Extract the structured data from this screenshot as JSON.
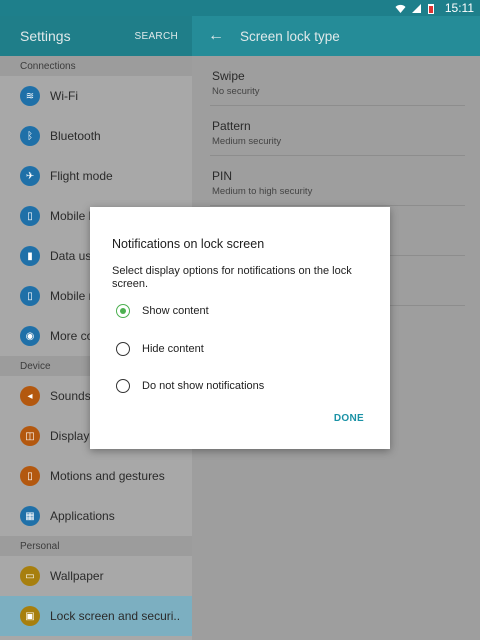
{
  "status": {
    "time": "15:11"
  },
  "left_header": {
    "title": "Settings",
    "search": "SEARCH"
  },
  "right_header": {
    "title": "Screen lock type"
  },
  "sidebar": {
    "sections": [
      {
        "label": "Connections",
        "items": [
          {
            "label": "Wi-Fi",
            "icon": "wifi-icon",
            "glyph": "≋"
          },
          {
            "label": "Bluetooth",
            "icon": "bluetooth-icon",
            "glyph": "ᛒ"
          },
          {
            "label": "Flight mode",
            "icon": "airplane-icon",
            "glyph": "✈"
          },
          {
            "label": "Mobile h",
            "icon": "mobile-hotspot-icon",
            "glyph": "▯"
          },
          {
            "label": "Data usa",
            "icon": "data-usage-icon",
            "glyph": "▮"
          },
          {
            "label": "Mobile n",
            "icon": "mobile-network-icon",
            "glyph": "▯"
          },
          {
            "label": "More co",
            "icon": "more-connections-icon",
            "glyph": "◉"
          }
        ]
      },
      {
        "label": "Device",
        "items": [
          {
            "label": "Sounds",
            "icon": "sound-icon",
            "glyph": "◂"
          },
          {
            "label": "Display",
            "icon": "display-icon",
            "glyph": "◫"
          },
          {
            "label": "Motions and gestures",
            "icon": "motion-icon",
            "glyph": "▯"
          },
          {
            "label": "Applications",
            "icon": "applications-icon",
            "glyph": "▦"
          }
        ]
      },
      {
        "label": "Personal",
        "items": [
          {
            "label": "Wallpaper",
            "icon": "wallpaper-icon",
            "glyph": "▭"
          },
          {
            "label": "Lock screen and securi..",
            "icon": "lock-icon",
            "glyph": "▣",
            "active": true
          }
        ]
      }
    ]
  },
  "lock_options": [
    {
      "title": "Swipe",
      "subtitle": "No security"
    },
    {
      "title": "Pattern",
      "subtitle": "Medium security"
    },
    {
      "title": "PIN",
      "subtitle": "Medium to high security"
    },
    {
      "title": "",
      "subtitle": ""
    },
    {
      "title": "",
      "subtitle": ""
    }
  ],
  "dialog": {
    "title": "Notifications on lock screen",
    "description": "Select display options for notifications on the lock screen.",
    "options": [
      {
        "label": "Show content",
        "checked": true
      },
      {
        "label": "Hide content",
        "checked": false
      },
      {
        "label": "Do not show notifications",
        "checked": false
      }
    ],
    "done_label": "DONE"
  },
  "colors": {
    "status_bar": "#1e7f8b",
    "header_left": "#1f7e89",
    "header_right": "#258c98",
    "accent_radio": "#4cb050",
    "done": "#1a92a6"
  }
}
